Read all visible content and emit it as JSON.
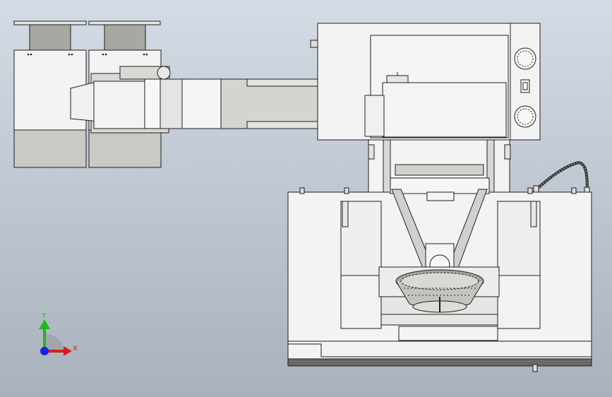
{
  "triad": {
    "x_label": "X",
    "y_label": "Y",
    "x_color": "#dd1c1c",
    "y_color": "#1fb81f",
    "z_color": "#1a1fe0"
  },
  "colors": {
    "background_top": "#d3dbe5",
    "background_bottom": "#a9b2bc",
    "body": "#f3f3f3",
    "shade": "#c9c9c6",
    "dark": "#8c8c86",
    "outline": "#1f1f1f"
  }
}
